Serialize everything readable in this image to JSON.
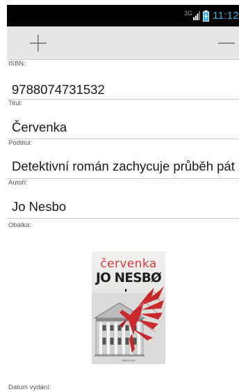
{
  "status_bar": {
    "network": "3G",
    "time": "11:12",
    "signal_icon": "signal-icon",
    "battery_icon": "battery-charging-icon"
  },
  "action_bar": {
    "add_icon": "plus-icon",
    "remove_icon": "minus-icon"
  },
  "fields": {
    "isbn": {
      "label": "ISBN:",
      "value": "9788074731532"
    },
    "title": {
      "label": "Titul:",
      "value": "Červenka"
    },
    "subtitle": {
      "label": "Podtitul:",
      "value": "Detektivní román zachycuje průběh pát"
    },
    "authors": {
      "label": "Autoři:",
      "value": "Jo Nesbo"
    },
    "cover": {
      "label": "Obálka:"
    },
    "published": {
      "label": "Datum vydání:"
    }
  },
  "cover_art": {
    "title": "červenka",
    "author": "JO NESBØ",
    "publisher_mark": "KNIHA ZLIN"
  },
  "colors": {
    "status_background": "#000000",
    "clock": "#33b5e5",
    "action_bar_background": "#e6e6e6",
    "cover_red": "#d23b3f"
  }
}
